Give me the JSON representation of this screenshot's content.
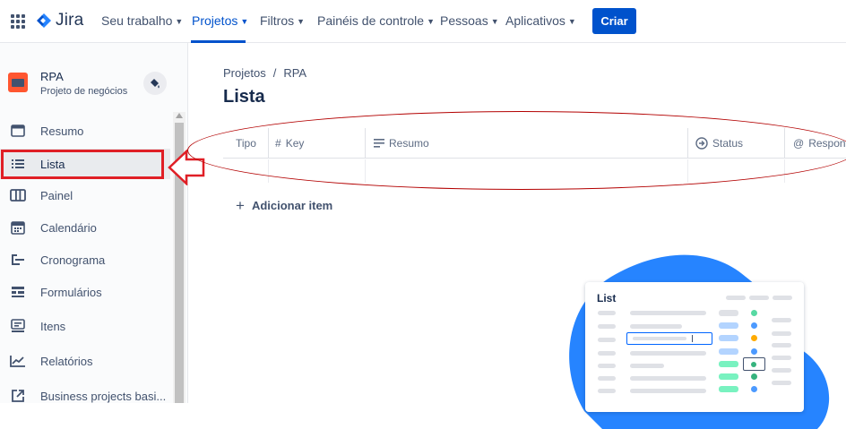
{
  "topnav": {
    "logo": "Jira",
    "items": [
      {
        "label": "Seu trabalho",
        "active": false
      },
      {
        "label": "Projetos",
        "active": true
      },
      {
        "label": "Filtros",
        "active": false
      },
      {
        "label": "Painéis de controle",
        "active": false
      },
      {
        "label": "Pessoas",
        "active": false
      },
      {
        "label": "Aplicativos",
        "active": false
      }
    ],
    "create_label": "Criar"
  },
  "sidebar": {
    "project_name": "RPA",
    "project_type": "Projeto de negócios",
    "items": [
      {
        "label": "Resumo",
        "icon": "summary-icon"
      },
      {
        "label": "Lista",
        "icon": "list-icon",
        "selected": true
      },
      {
        "label": "Painel",
        "icon": "board-icon"
      },
      {
        "label": "Calendário",
        "icon": "calendar-icon"
      },
      {
        "label": "Cronograma",
        "icon": "timeline-icon"
      },
      {
        "label": "Formulários",
        "icon": "form-icon"
      },
      {
        "label": "Itens",
        "icon": "issues-icon"
      },
      {
        "label": "Relatórios",
        "icon": "reports-icon"
      },
      {
        "label": "Business projects basi...",
        "icon": "external-link-icon"
      }
    ]
  },
  "main": {
    "breadcrumb": [
      "Projetos",
      "/",
      "RPA"
    ],
    "title": "Lista",
    "columns": [
      "Tipo",
      "Key",
      "Resumo",
      "Status",
      "Respon"
    ],
    "add_item_label": "Adicionar item"
  },
  "illustration": {
    "title": "List"
  },
  "colors": {
    "brand": "#0052cc",
    "highlight": "#e01f26",
    "blob": "#2684ff"
  }
}
